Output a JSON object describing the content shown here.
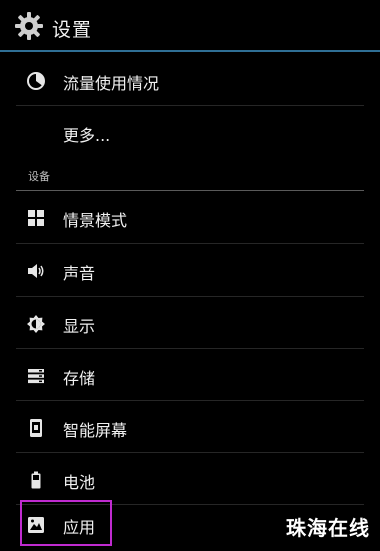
{
  "header": {
    "title": "设置",
    "icon": "gear-icon"
  },
  "items_top": [
    {
      "label": "流量使用情况",
      "icon": "data-usage-icon"
    },
    {
      "label": "更多...",
      "icon": ""
    }
  ],
  "section": {
    "label": "设备"
  },
  "items_device": [
    {
      "label": "情景模式",
      "icon": "profiles-icon"
    },
    {
      "label": "声音",
      "icon": "sound-icon"
    },
    {
      "label": "显示",
      "icon": "display-icon"
    },
    {
      "label": "存储",
      "icon": "storage-icon"
    },
    {
      "label": "智能屏幕",
      "icon": "smart-screen-icon"
    },
    {
      "label": "电池",
      "icon": "battery-icon"
    },
    {
      "label": "应用",
      "icon": "apps-icon"
    }
  ],
  "watermark": "珠海在线",
  "colors": {
    "background": "#000000",
    "accent_line": "#2f6f95",
    "highlight": "#c02bd0"
  }
}
